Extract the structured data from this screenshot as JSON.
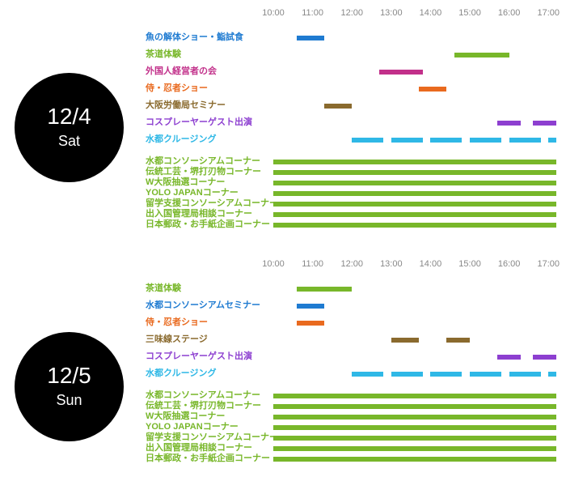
{
  "timeline": {
    "start_hour": 10,
    "end_hour": 17,
    "hour_labels": [
      "10:00",
      "11:00",
      "12:00",
      "13:00",
      "14:00",
      "15:00",
      "16:00",
      "17:00"
    ]
  },
  "chart_data": [
    {
      "type": "gantt",
      "date_main": "12/4",
      "date_sub": "Sat",
      "x_range": [
        10,
        17
      ],
      "x_ticks": [
        "10:00",
        "11:00",
        "12:00",
        "13:00",
        "14:00",
        "15:00",
        "16:00",
        "17:00"
      ],
      "events": [
        {
          "label": "魚の解体ショー・鮨試食",
          "color": "#1f7bd1",
          "segments": [
            [
              10.6,
              11.3
            ]
          ]
        },
        {
          "label": "茶道体験",
          "color": "#78b72a",
          "segments": [
            [
              14.6,
              16.0
            ]
          ]
        },
        {
          "label": "外国人経営者の会",
          "color": "#c2308a",
          "segments": [
            [
              12.7,
              13.8
            ]
          ]
        },
        {
          "label": "侍・忍者ショー",
          "color": "#e96a1f",
          "segments": [
            [
              13.7,
              14.4
            ]
          ]
        },
        {
          "label": "大阪労働局セミナー",
          "color": "#8a6a2e",
          "segments": [
            [
              11.3,
              12.0
            ]
          ]
        },
        {
          "label": "コスプレーヤーゲスト出演",
          "color": "#8d3fd0",
          "segments": [
            [
              15.7,
              16.3
            ],
            [
              16.6,
              17.2
            ]
          ]
        },
        {
          "label": "水都クルージング",
          "color": "#2fb8e6",
          "segments": [
            [
              12.0,
              12.8
            ],
            [
              13.0,
              13.8
            ],
            [
              14.0,
              14.8
            ],
            [
              15.0,
              15.8
            ],
            [
              16.0,
              16.8
            ],
            [
              17.0,
              17.2
            ]
          ]
        }
      ],
      "booths": [
        {
          "label": "水都コンソーシアムコーナー",
          "color": "#78b72a",
          "segments": [
            [
              10.0,
              17.2
            ]
          ]
        },
        {
          "label": "伝統工芸・堺打刃物コーナー",
          "color": "#78b72a",
          "segments": [
            [
              10.0,
              17.2
            ]
          ]
        },
        {
          "label": "W大阪抽選コーナー",
          "color": "#78b72a",
          "segments": [
            [
              10.0,
              17.2
            ]
          ]
        },
        {
          "label": "YOLO JAPANコーナー",
          "color": "#78b72a",
          "segments": [
            [
              10.0,
              17.2
            ]
          ]
        },
        {
          "label": "留学支援コンソーシアムコーナー",
          "color": "#78b72a",
          "segments": [
            [
              10.0,
              17.2
            ]
          ]
        },
        {
          "label": "出入国管理局相談コーナー",
          "color": "#78b72a",
          "segments": [
            [
              10.0,
              17.2
            ]
          ]
        },
        {
          "label": "日本郵政・お手紙企画コーナー",
          "color": "#78b72a",
          "segments": [
            [
              10.0,
              17.2
            ]
          ]
        }
      ]
    },
    {
      "type": "gantt",
      "date_main": "12/5",
      "date_sub": "Sun",
      "x_range": [
        10,
        17
      ],
      "x_ticks": [
        "10:00",
        "11:00",
        "12:00",
        "13:00",
        "14:00",
        "15:00",
        "16:00",
        "17:00"
      ],
      "events": [
        {
          "label": "茶道体験",
          "color": "#78b72a",
          "segments": [
            [
              10.6,
              12.0
            ]
          ]
        },
        {
          "label": "水都コンソーシアムセミナー",
          "color": "#1f7bd1",
          "segments": [
            [
              10.6,
              11.3
            ]
          ]
        },
        {
          "label": "侍・忍者ショー",
          "color": "#e96a1f",
          "segments": [
            [
              10.6,
              11.3
            ]
          ]
        },
        {
          "label": "三味線ステージ",
          "color": "#8a6a2e",
          "segments": [
            [
              13.0,
              13.7
            ],
            [
              14.4,
              15.0
            ]
          ]
        },
        {
          "label": "コスプレーヤーゲスト出演",
          "color": "#8d3fd0",
          "segments": [
            [
              15.7,
              16.3
            ],
            [
              16.6,
              17.2
            ]
          ]
        },
        {
          "label": "水都クルージング",
          "color": "#2fb8e6",
          "segments": [
            [
              12.0,
              12.8
            ],
            [
              13.0,
              13.8
            ],
            [
              14.0,
              14.8
            ],
            [
              15.0,
              15.8
            ],
            [
              16.0,
              16.8
            ],
            [
              17.0,
              17.2
            ]
          ]
        }
      ],
      "booths": [
        {
          "label": "水都コンソーシアムコーナー",
          "color": "#78b72a",
          "segments": [
            [
              10.0,
              17.2
            ]
          ]
        },
        {
          "label": "伝統工芸・堺打刃物コーナー",
          "color": "#78b72a",
          "segments": [
            [
              10.0,
              17.2
            ]
          ]
        },
        {
          "label": "W大阪抽選コーナー",
          "color": "#78b72a",
          "segments": [
            [
              10.0,
              17.2
            ]
          ]
        },
        {
          "label": "YOLO JAPANコーナー",
          "color": "#78b72a",
          "segments": [
            [
              10.0,
              17.2
            ]
          ]
        },
        {
          "label": "留学支援コンソーシアムコーナー",
          "color": "#78b72a",
          "segments": [
            [
              10.0,
              17.2
            ]
          ]
        },
        {
          "label": "出入国管理局相談コーナー",
          "color": "#78b72a",
          "segments": [
            [
              10.0,
              17.2
            ]
          ]
        },
        {
          "label": "日本郵政・お手紙企画コーナー",
          "color": "#78b72a",
          "segments": [
            [
              10.0,
              17.2
            ]
          ]
        }
      ]
    }
  ],
  "layout": {
    "day_tops": [
      0,
      310
    ],
    "circle_tops": [
      90,
      410
    ],
    "rows_top": 34,
    "event_row_h": 21,
    "booth_row_h": 13,
    "booth_gap_before": 10,
    "label_w": 158,
    "track_span_hours": 7.2
  }
}
